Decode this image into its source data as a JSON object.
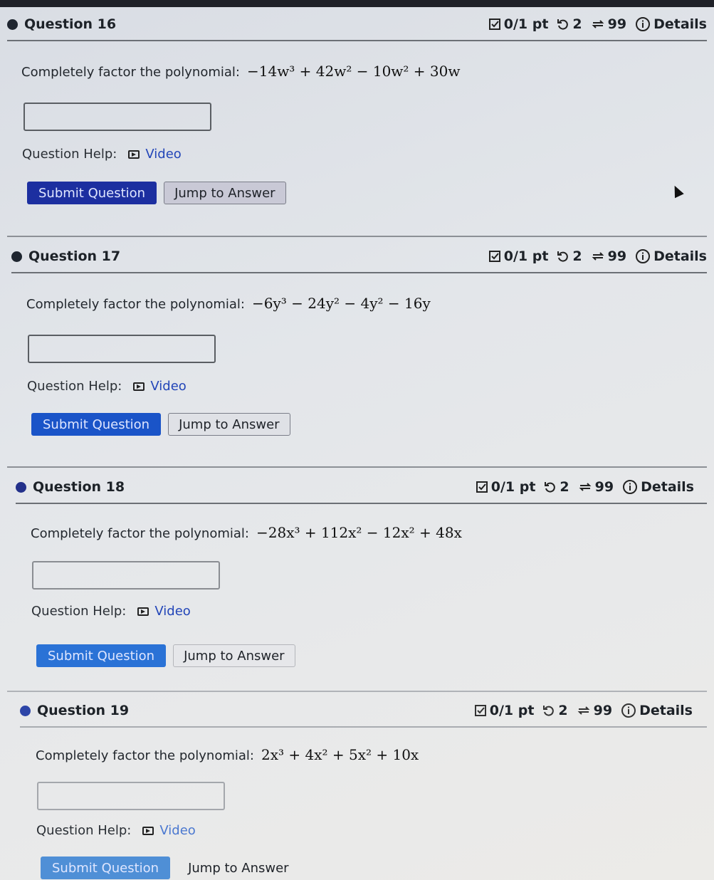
{
  "questions": [
    {
      "title": "Question 16",
      "score": "0/1 pt",
      "retries": "2",
      "attempts": "99",
      "details_label": "Details",
      "prompt": "Completely factor the polynomial:",
      "polynomial": "−14w³ + 42w² − 10w² + 30w",
      "answer_value": "",
      "help_label": "Question Help:",
      "video_label": "Video",
      "submit_label": "Submit Question",
      "jump_label": "Jump to Answer"
    },
    {
      "title": "Question 17",
      "score": "0/1 pt",
      "retries": "2",
      "attempts": "99",
      "details_label": "Details",
      "prompt": "Completely factor the polynomial:",
      "polynomial": "−6y³ − 24y² − 4y² − 16y",
      "answer_value": "",
      "help_label": "Question Help:",
      "video_label": "Video",
      "submit_label": "Submit Question",
      "jump_label": "Jump to Answer"
    },
    {
      "title": "Question 18",
      "score": "0/1 pt",
      "retries": "2",
      "attempts": "99",
      "details_label": "Details",
      "prompt": "Completely factor the polynomial:",
      "polynomial": "−28x³ + 112x² − 12x² + 48x",
      "answer_value": "",
      "help_label": "Question Help:",
      "video_label": "Video",
      "submit_label": "Submit Question",
      "jump_label": "Jump to Answer"
    },
    {
      "title": "Question 19",
      "score": "0/1 pt",
      "retries": "2",
      "attempts": "99",
      "details_label": "Details",
      "prompt": "Completely factor the polynomial:",
      "polynomial": "2x³ + 4x² + 5x² + 10x",
      "answer_value": "",
      "help_label": "Question Help:",
      "video_label": "Video",
      "submit_label": "Submit Question",
      "jump_label": "Jump to Answer"
    }
  ],
  "colors": {
    "submit_button": "#1c2fa0",
    "link": "#2245b8"
  }
}
